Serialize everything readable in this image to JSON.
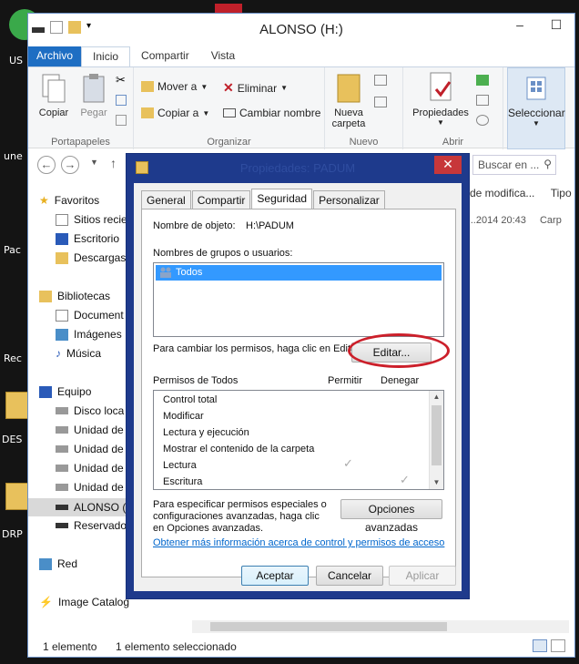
{
  "desktop": {
    "labels": [
      "US",
      "une",
      "Pac",
      "Rec",
      "DES",
      "DRP"
    ]
  },
  "explorer": {
    "title": "ALONSO (H:)",
    "window_controls": {
      "minimize": "–",
      "maximize": "☐",
      "close": "✕"
    },
    "ribbon_tabs": [
      "Archivo",
      "Inicio",
      "Compartir",
      "Vista"
    ],
    "ribbon": {
      "portapapeles": {
        "label": "Portapapeles",
        "copy": "Copiar",
        "paste": "Pegar"
      },
      "organizar": {
        "label": "Organizar",
        "move_to": "Mover a",
        "copy_to": "Copiar a",
        "delete": "Eliminar",
        "rename": "Cambiar nombre"
      },
      "nuevo": {
        "label": "Nuevo",
        "new_folder_line1": "Nueva",
        "new_folder_line2": "carpeta"
      },
      "abrir": {
        "label": "Abrir",
        "properties": "Propiedades"
      },
      "select": "Seleccionar"
    },
    "search_placeholder": "Buscar en ...",
    "column_headers": [
      "de modifica...",
      "Tipo"
    ],
    "row": {
      "date": "y...2014 20:43",
      "type": "Carp"
    },
    "sidebar": {
      "favorites": "Favoritos",
      "fav_items": [
        "Sitios recie",
        "Escritorio",
        "Descargas"
      ],
      "libraries": "Bibliotecas",
      "lib_items": [
        "Document",
        "Imágenes",
        "Música"
      ],
      "computer": "Equipo",
      "comp_items": [
        "Disco loca",
        "Unidad de",
        "Unidad de",
        "Unidad de",
        "Unidad de",
        "ALONSO (",
        "Reservado"
      ],
      "network": "Red",
      "image_catalog": "Image Catalog"
    },
    "status": {
      "count": "1 elemento",
      "selected": "1 elemento seleccionado"
    }
  },
  "dialog": {
    "title": "Propiedades: PADUM",
    "close": "✕",
    "tabs": [
      "General",
      "Compartir",
      "Seguridad",
      "Personalizar"
    ],
    "object_name_label": "Nombre de objeto:",
    "object_name_value": "H:\\PADUM",
    "groups_label": "Nombres de grupos o usuarios:",
    "groups": [
      "Todos"
    ],
    "change_perm_text": "Para cambiar los permisos, haga clic en Editar.",
    "edit_button": "Editar...",
    "perm_for_label": "Permisos de Todos",
    "allow_label": "Permitir",
    "deny_label": "Denegar",
    "permissions": [
      {
        "name": "Control total",
        "allow": "",
        "deny": ""
      },
      {
        "name": "Modificar",
        "allow": "",
        "deny": ""
      },
      {
        "name": "Lectura y ejecución",
        "allow": "",
        "deny": ""
      },
      {
        "name": "Mostrar el contenido de la carpeta",
        "allow": "",
        "deny": ""
      },
      {
        "name": "Lectura",
        "allow": "✓",
        "deny": ""
      },
      {
        "name": "Escritura",
        "allow": "",
        "deny": "✓"
      }
    ],
    "special_text_1": "Para especificar permisos especiales o",
    "special_text_2": "configuraciones avanzadas, haga clic",
    "special_text_3": "en Opciones avanzadas.",
    "advanced_button": "Opciones avanzadas",
    "more_info_link": "Obtener más información acerca de control y permisos de acceso",
    "accept": "Aceptar",
    "cancel": "Cancelar",
    "apply": "Aplicar"
  }
}
